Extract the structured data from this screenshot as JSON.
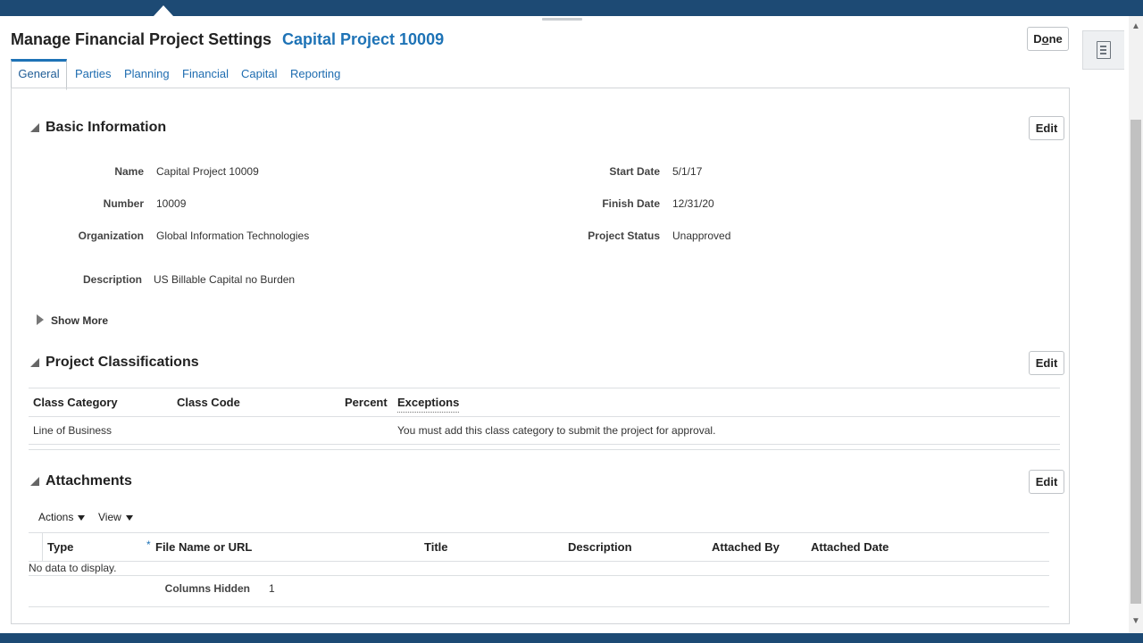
{
  "header": {
    "title": "Manage Financial Project Settings",
    "subtitle": "Capital Project 10009",
    "done_prefix": "D",
    "done_underline": "o",
    "done_suffix": "ne"
  },
  "tabs": [
    {
      "label": "General",
      "active": true
    },
    {
      "label": "Parties"
    },
    {
      "label": "Planning"
    },
    {
      "label": "Financial"
    },
    {
      "label": "Capital"
    },
    {
      "label": "Reporting"
    }
  ],
  "basic_info": {
    "title": "Basic Information",
    "edit_label": "Edit",
    "fields": {
      "name_label": "Name",
      "name_value": "Capital Project 10009",
      "number_label": "Number",
      "number_value": "10009",
      "org_label": "Organization",
      "org_value": "Global Information Technologies",
      "desc_label": "Description",
      "desc_value": "US Billable Capital no Burden",
      "start_label": "Start Date",
      "start_value": "5/1/17",
      "finish_label": "Finish Date",
      "finish_value": "12/31/20",
      "status_label": "Project Status",
      "status_value": "Unapproved"
    },
    "show_more": "Show More"
  },
  "classifications": {
    "title": "Project Classifications",
    "edit_label": "Edit",
    "columns": [
      "Class Category",
      "Class Code",
      "Percent",
      "Exceptions"
    ],
    "rows": [
      {
        "category": "Line of Business",
        "code": "",
        "percent": "",
        "exceptions": "You must add this class category to submit the project for approval."
      }
    ]
  },
  "attachments": {
    "title": "Attachments",
    "edit_label": "Edit",
    "actions_menu": "Actions",
    "view_menu": "View",
    "required_mark": "*",
    "columns": [
      "Type",
      "File Name or URL",
      "Title",
      "Description",
      "Attached By",
      "Attached Date"
    ],
    "empty_text": "No data to display.",
    "columns_hidden_label": "Columns Hidden",
    "columns_hidden_value": "1"
  },
  "icons": {
    "side_panel": "document-list-icon",
    "expand": "triangle-right-icon",
    "collapse": "triangle-down-icon",
    "menu_caret": "caret-down-icon"
  },
  "colors": {
    "frame": "#1d4a74",
    "link": "#1e73b6"
  }
}
